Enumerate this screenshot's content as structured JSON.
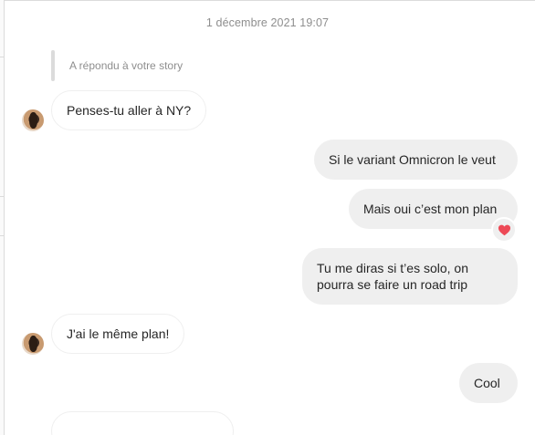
{
  "conversation": {
    "timestamp": "1 décembre 2021 19:07",
    "story_reply_label": "A répondu à votre story",
    "messages": [
      {
        "sender": "other",
        "text": "Penses-tu aller à NY?"
      },
      {
        "sender": "me",
        "text": "Si le variant Omnicron le veut"
      },
      {
        "sender": "me",
        "text": "Mais oui c’est mon plan",
        "reaction": "red-heart"
      },
      {
        "sender": "me",
        "text": "Tu me diras si t’es solo, on pourra se faire un road trip"
      },
      {
        "sender": "other",
        "text": "J'ai le même plan!"
      },
      {
        "sender": "me",
        "text": "Cool"
      },
      {
        "sender": "other",
        "text": ""
      }
    ]
  },
  "colors": {
    "incoming_bubble": "#ffffff",
    "outgoing_bubble": "#efefef",
    "meta_text": "#8e8e8e",
    "heart": "#ed4956"
  }
}
